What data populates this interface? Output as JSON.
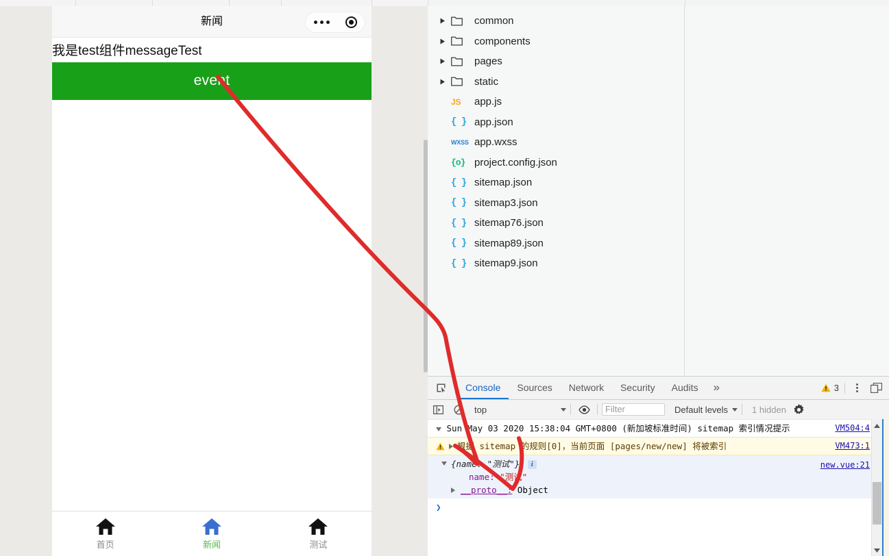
{
  "simulator": {
    "nav_title": "新闻",
    "capsule": {
      "menu_icon": "ellipsis-icon",
      "target_icon": "target-circle-icon"
    },
    "message_text": "我是test组件messageTest",
    "event_button_label": "event",
    "event_button_color": "#19a019",
    "tabbar": [
      {
        "label": "首页",
        "icon": "home-icon",
        "icon_color": "#111111",
        "label_color": "#8a8a8a",
        "active": false
      },
      {
        "label": "新闻",
        "icon": "home-icon",
        "icon_color": "#3a6fd0",
        "label_color": "#5ab552",
        "active": true
      },
      {
        "label": "测试",
        "icon": "home-icon",
        "icon_color": "#111111",
        "label_color": "#8a8a8a",
        "active": false
      }
    ]
  },
  "filetree": {
    "rows": [
      {
        "name": "common",
        "type": "folder",
        "expandable": true,
        "icon": "folder-icon"
      },
      {
        "name": "components",
        "type": "folder",
        "expandable": true,
        "icon": "folder-icon"
      },
      {
        "name": "pages",
        "type": "folder",
        "expandable": true,
        "icon": "folder-icon"
      },
      {
        "name": "static",
        "type": "folder",
        "expandable": true,
        "icon": "folder-icon"
      },
      {
        "name": "app.js",
        "type": "js",
        "expandable": false,
        "icon": "js-file-icon",
        "badge": "JS"
      },
      {
        "name": "app.json",
        "type": "json",
        "expandable": false,
        "icon": "json-file-icon",
        "badge": "{ }"
      },
      {
        "name": "app.wxss",
        "type": "wxss",
        "expandable": false,
        "icon": "wxss-file-icon",
        "badge": "WXSS"
      },
      {
        "name": "project.config.json",
        "type": "pcjson",
        "expandable": false,
        "icon": "config-file-icon",
        "badge": "{o}"
      },
      {
        "name": "sitemap.json",
        "type": "json",
        "expandable": false,
        "icon": "json-file-icon",
        "badge": "{ }"
      },
      {
        "name": "sitemap3.json",
        "type": "json",
        "expandable": false,
        "icon": "json-file-icon",
        "badge": "{ }"
      },
      {
        "name": "sitemap76.json",
        "type": "json",
        "expandable": false,
        "icon": "json-file-icon",
        "badge": "{ }"
      },
      {
        "name": "sitemap89.json",
        "type": "json",
        "expandable": false,
        "icon": "json-file-icon",
        "badge": "{ }"
      },
      {
        "name": "sitemap9.json",
        "type": "json",
        "expandable": false,
        "icon": "json-file-icon",
        "badge": "{ }"
      }
    ]
  },
  "devtools": {
    "inspect_icon": "inspect-element-icon",
    "tabs": [
      {
        "label": "Console",
        "active": true
      },
      {
        "label": "Sources",
        "active": false
      },
      {
        "label": "Network",
        "active": false
      },
      {
        "label": "Security",
        "active": false
      },
      {
        "label": "Audits",
        "active": false
      }
    ],
    "more_tabs_label": "»",
    "warning_count": "3",
    "warning_icon": "warning-triangle-icon",
    "kebab_icon": "more-vertical-icon",
    "dock_icon": "dock-panel-icon",
    "filterbar": {
      "sidebar_toggle_icon": "console-sidebar-icon",
      "clear_icon": "clear-console-icon",
      "context": "top",
      "eye_icon": "live-expression-icon",
      "filter_placeholder": "Filter",
      "filter_value": "",
      "levels_label": "Default levels",
      "hidden_label": "1 hidden",
      "settings_icon": "gear-icon"
    },
    "console_rows": [
      {
        "kind": "log",
        "expander": "triangle-down-icon",
        "text": "Sun May 03 2020 15:38:04 GMT+0800 (新加坡标准时间) sitemap 索引情况提示",
        "source": "VM504:4"
      },
      {
        "kind": "warning",
        "icon": "warning-triangle-icon",
        "expander": "triangle-right-icon",
        "text": "根据 sitemap 的规则[0]，当前页面 [pages/new/new] 将被索引",
        "source": "VM473:1"
      },
      {
        "kind": "object",
        "expander": "triangle-down-icon",
        "preview": "{name: \"测试\"}",
        "badge": "info-badge",
        "source": "new.vue:21",
        "props": [
          {
            "key": "name:",
            "value": "\"测试\""
          },
          {
            "key": "__proto__:",
            "value": "Object",
            "expander": "triangle-right-icon"
          }
        ]
      }
    ],
    "prompt_symbol": "❯"
  },
  "annotation": {
    "color": "#e02b2b",
    "description": "hand-drawn arrow from event button to console object output"
  }
}
